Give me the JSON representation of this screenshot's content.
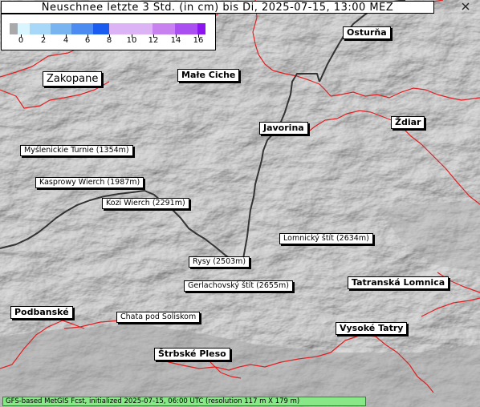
{
  "title": "Neuschnee letzte 3 Std. (in cm) bis Di, 2025-07-15, 13:00 MEZ",
  "legend": {
    "colors": [
      "#a9a9a9",
      "#d9f5ff",
      "#a8d8f8",
      "#78b4f0",
      "#4c8cf0",
      "#1a5cf0",
      "#dcb4f5",
      "#c882f0",
      "#aa50f0",
      "#8c14f0"
    ],
    "labels": [
      "0",
      "2",
      "4",
      "6",
      "8",
      "10",
      "12",
      "14",
      "16"
    ]
  },
  "places": {
    "zakopane": "Zakopane",
    "male_ciche": "Małe Ciche",
    "osturna": "Osturňa",
    "javorina": "Javorina",
    "zdiar": "Ždiar",
    "tatranska_lomnica": "Tatranská Lomnica",
    "podbanske": "Podbanské",
    "vysoke_tatry": "Vysoké Tatry",
    "strbske_pleso": "Štrbské Pleso"
  },
  "peaks": {
    "mysl": "Myślenickie Turnie (1354m)",
    "kasprowy": "Kasprowy Wierch (1987m)",
    "kozi": "Kozi Wierch (2291m)",
    "lomnicky": "Lomnický štít (2634m)",
    "rysy": "Rysy (2503m)",
    "gerlach": "Gerlachovský štít (2655m)",
    "chata": "Chata pod Soliskom"
  },
  "footer": "GFS-based MetGIS Fcst, initialized 2025-07-15, 06:00 UTC  (resolution 117 m X 179 m)",
  "colors": {
    "border_red": "#e02020",
    "border_dark": "#333333",
    "footer_green": "#88e888"
  }
}
